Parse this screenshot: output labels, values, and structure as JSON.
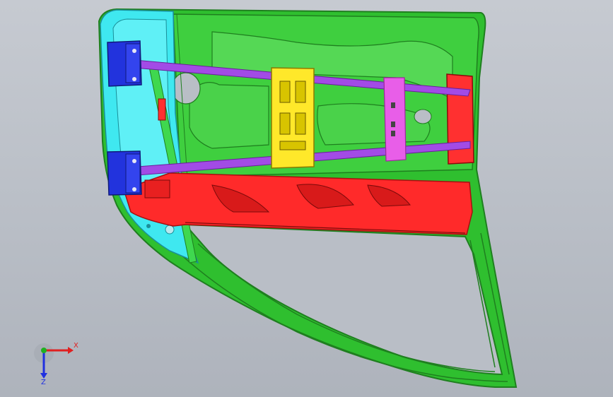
{
  "viewport": {
    "background_top": "#c6cad1",
    "background_bottom": "#aeb3bc"
  },
  "model": {
    "colors": {
      "outer_frame": "#2fbf2f",
      "outer_frame_dark": "#1f7f1f",
      "inner_panel": "#3fcf3f",
      "hinge_panel": "#3fe8f0",
      "belt_reinforcement": "#ff2a2a",
      "clamp_blocks": "#2233dd",
      "fixture_bars": "#a24be6",
      "center_plate": "#ffe82a",
      "bracket": "#e85ee8",
      "latch_plate": "#ff3030",
      "opening": "#b9bec6"
    }
  },
  "triad": {
    "x_label": "X",
    "z_label": "Z",
    "x_color": "#e02020",
    "z_color": "#2030e0",
    "y_color": "#20b020"
  }
}
